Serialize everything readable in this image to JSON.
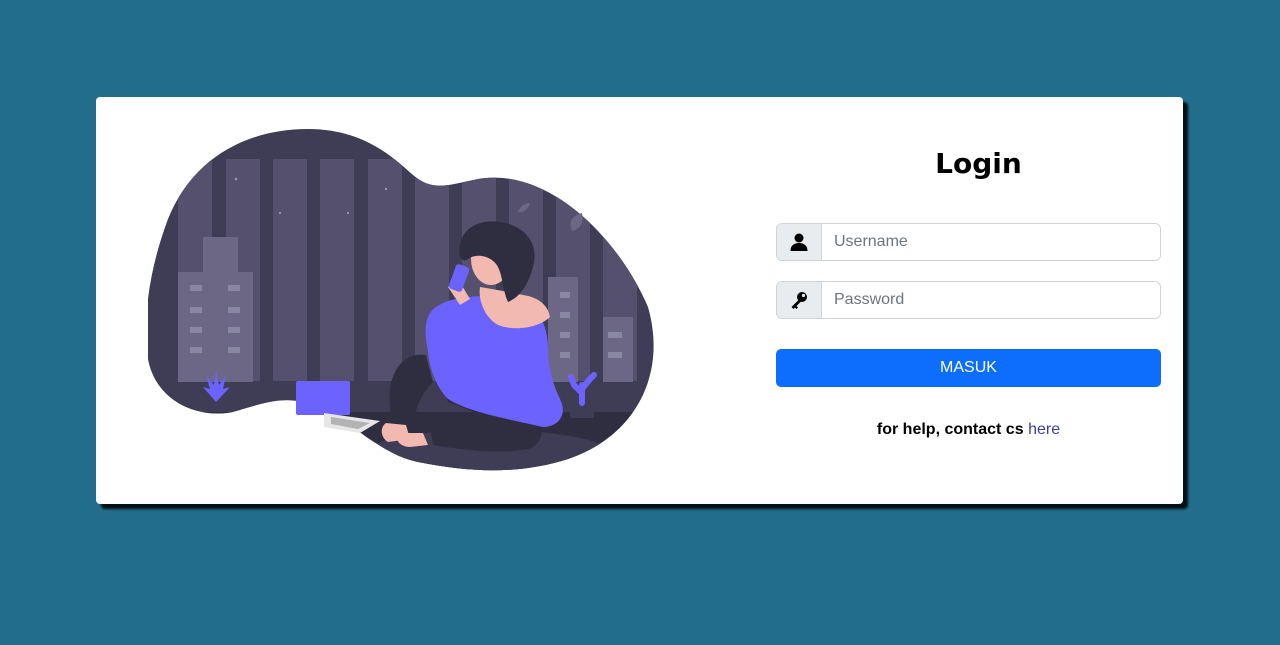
{
  "page": {
    "background_color": "#216d8b",
    "card_color": "#ffffff"
  },
  "illustration": {
    "icon": "woman-on-phone-illustration",
    "blob_color": "#3f3d56",
    "accent_color": "#6c63ff"
  },
  "login": {
    "title": "Login",
    "username": {
      "icon": "user-icon",
      "placeholder": "Username",
      "value": ""
    },
    "password": {
      "icon": "key-icon",
      "placeholder": "Password",
      "value": ""
    },
    "submit_label": "MASUK",
    "submit_color": "#0d6efd",
    "help_text": "for help, contact cs",
    "help_link_label": "here",
    "help_link_color": "#3f3fa0"
  }
}
